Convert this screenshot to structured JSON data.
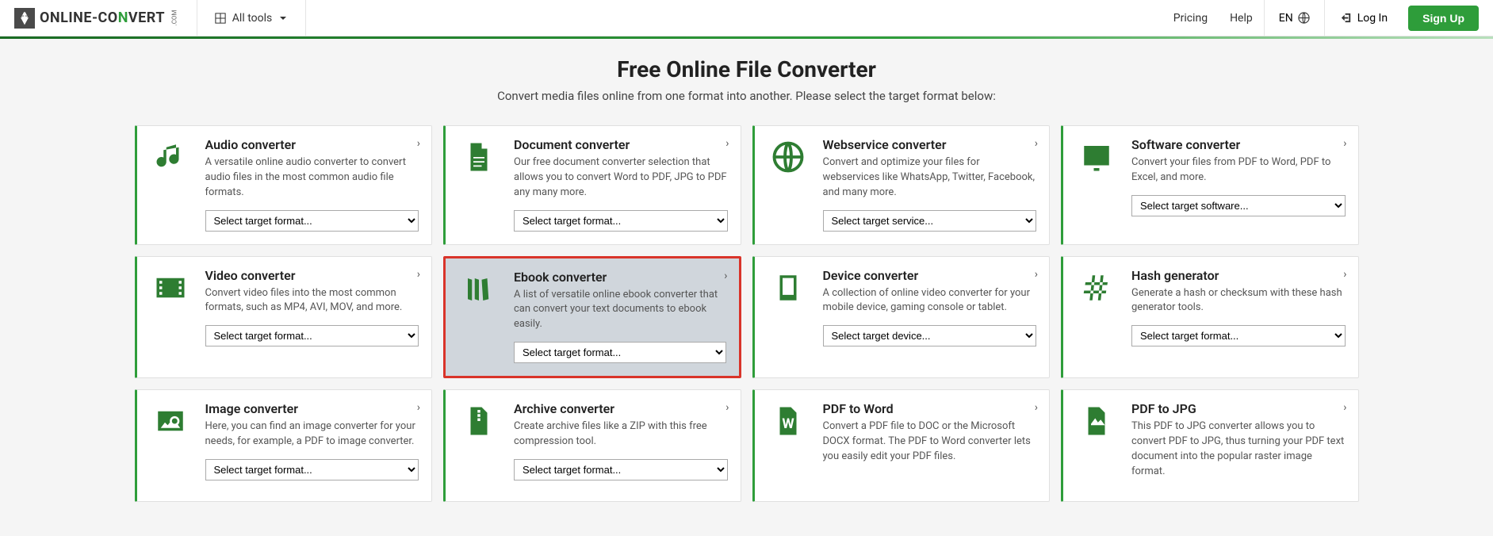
{
  "header": {
    "logo_text_1": "ONLINE-",
    "logo_text_2": "CO",
    "logo_text_3": "N",
    "logo_text_4": "VERT",
    "logo_com": ".COM",
    "all_tools": "All tools",
    "pricing": "Pricing",
    "help": "Help",
    "lang": "EN",
    "login": "Log In",
    "signup": "Sign Up"
  },
  "hero": {
    "title": "Free Online File Converter",
    "subtitle": "Convert media files online from one format into another. Please select the target format below:"
  },
  "cards": [
    {
      "title": "Audio converter",
      "desc": "A versatile online audio converter to convert audio files in the most common audio file formats.",
      "select": "Select target format...",
      "has_select": true,
      "icon": "audio",
      "highlighted": false
    },
    {
      "title": "Document converter",
      "desc": "Our free document converter selection that allows you to convert Word to PDF, JPG to PDF any many more.",
      "select": "Select target format...",
      "has_select": true,
      "icon": "document",
      "highlighted": false
    },
    {
      "title": "Webservice converter",
      "desc": "Convert and optimize your files for webservices like WhatsApp, Twitter, Facebook, and many more.",
      "select": "Select target service...",
      "has_select": true,
      "icon": "globe",
      "highlighted": false
    },
    {
      "title": "Software converter",
      "desc": "Convert your files from PDF to Word, PDF to Excel, and more.",
      "select": "Select target software...",
      "has_select": true,
      "icon": "software",
      "highlighted": false
    },
    {
      "title": "Video converter",
      "desc": "Convert video files into the most common formats, such as MP4, AVI, MOV, and more.",
      "select": "Select target format...",
      "has_select": true,
      "icon": "video",
      "highlighted": false
    },
    {
      "title": "Ebook converter",
      "desc": "A list of versatile online ebook converter that can convert your text documents to ebook easily.",
      "select": "Select target format...",
      "has_select": true,
      "icon": "ebook",
      "highlighted": true
    },
    {
      "title": "Device converter",
      "desc": "A collection of online video converter for your mobile device, gaming console or tablet.",
      "select": "Select target device...",
      "has_select": true,
      "icon": "device",
      "highlighted": false
    },
    {
      "title": "Hash generator",
      "desc": "Generate a hash or checksum with these hash generator tools.",
      "select": "Select target format...",
      "has_select": true,
      "icon": "hash",
      "highlighted": false
    },
    {
      "title": "Image converter",
      "desc": "Here, you can find an image converter for your needs, for example, a PDF to image converter.",
      "select": "Select target format...",
      "has_select": true,
      "icon": "image",
      "highlighted": false
    },
    {
      "title": "Archive converter",
      "desc": "Create archive files like a ZIP with this free compression tool.",
      "select": "Select target format...",
      "has_select": true,
      "icon": "archive",
      "highlighted": false
    },
    {
      "title": "PDF to Word",
      "desc": "Convert a PDF file to DOC or the Microsoft DOCX format. The PDF to Word converter lets you easily edit your PDF files.",
      "select": "",
      "has_select": false,
      "icon": "word",
      "highlighted": false
    },
    {
      "title": "PDF to JPG",
      "desc": "This PDF to JPG converter allows you to convert PDF to JPG, thus turning your PDF text document into the popular raster image format.",
      "select": "",
      "has_select": false,
      "icon": "jpg",
      "highlighted": false
    }
  ]
}
